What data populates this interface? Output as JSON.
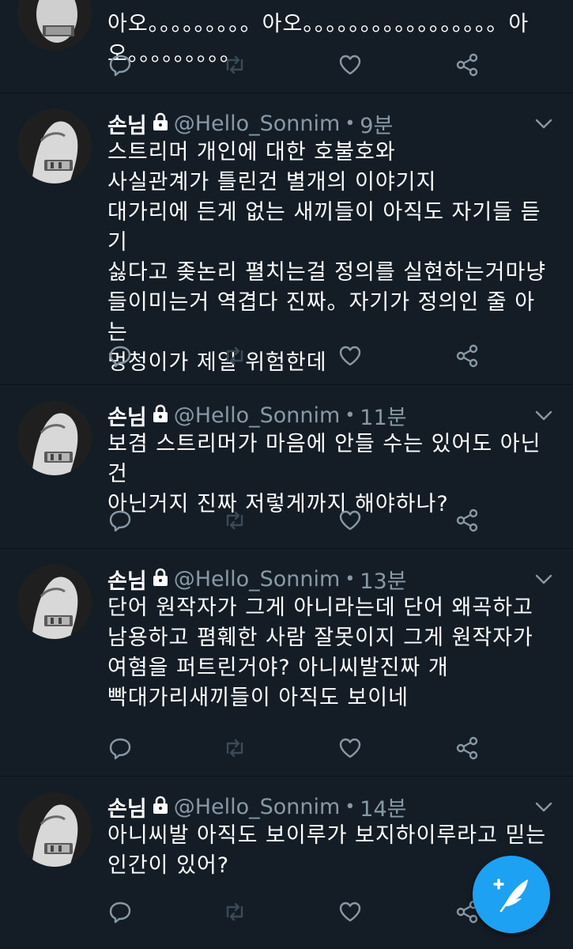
{
  "tweets": [
    {
      "name": "",
      "handle": "",
      "time": "",
      "text": "아오。。。。。。。。。아오。。。。。。。。。。。。。。。。。아오。。。。。。。。。"
    },
    {
      "name": "손님",
      "handle": "@Hello_Sonnim",
      "time": "9분",
      "text": "스트리머 개인에 대한 호불호와\n사실관계가 틀린건 별개의 이야기지\n대가리에 든게 없는 새끼들이 아직도 자기들 듣기\n싫다고 좆논리 펼치는걸 정의를 실현하는거마냥\n들이미는거 역겹다 진짜。자기가 정의인 줄 아는\n멍청이가 제일 위험한데"
    },
    {
      "name": "손님",
      "handle": "@Hello_Sonnim",
      "time": "11분",
      "text": "보겸 스트리머가 마음에 안들 수는 있어도 아닌건\n아닌거지 진짜 저렇게까지 해야하나?"
    },
    {
      "name": "손님",
      "handle": "@Hello_Sonnim",
      "time": "13분",
      "text": "단어 원작자가 그게 아니라는데 단어 왜곡하고\n남용하고 폄훼한 사람 잘못이지 그게 원작자가\n여혐을 퍼트린거야? 아니씨발진짜 개\n빡대가리새끼들이 아직도 보이네"
    },
    {
      "name": "손님",
      "handle": "@Hello_Sonnim",
      "time": "14분",
      "text": "아니씨발 아직도 보이루가 보지하이루라고 믿는\n인간이 있어?"
    }
  ],
  "icons": {
    "reply": "reply-icon",
    "retweet": "retweet-icon",
    "like": "heart-icon",
    "share": "share-icon",
    "compose": "compose-tweet-icon"
  },
  "colors": {
    "background": "#141d26",
    "muted": "#8899a6",
    "accent": "#1da1f2"
  }
}
